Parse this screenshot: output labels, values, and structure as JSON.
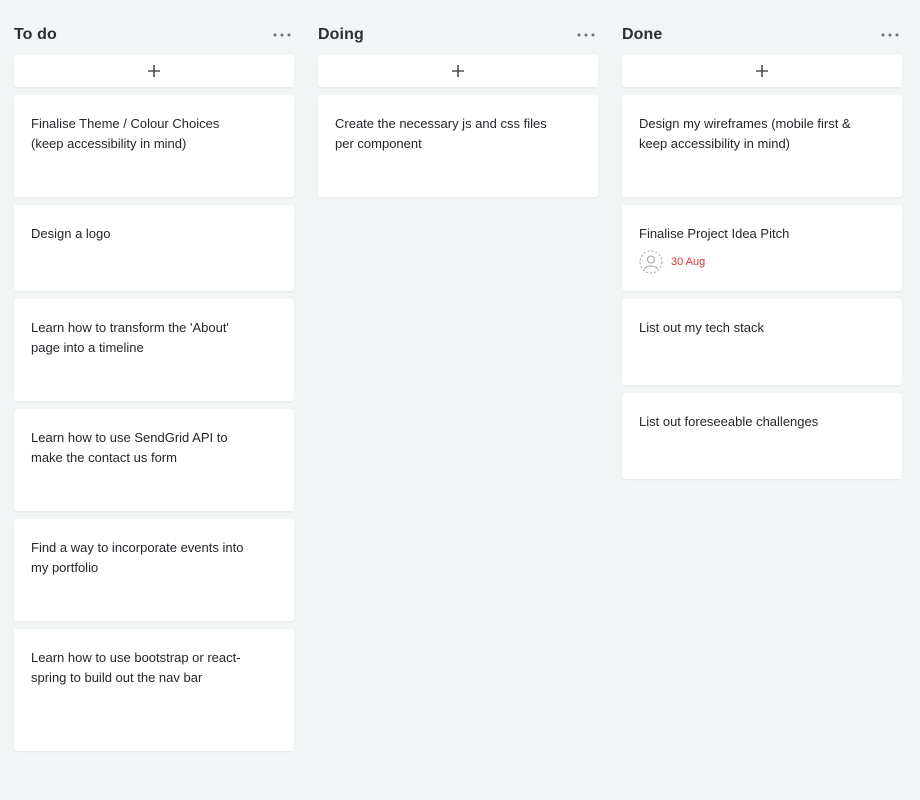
{
  "board": {
    "columns": [
      {
        "title": "To do",
        "cards": [
          {
            "text": "Finalise Theme / Colour Choices (keep accessibility in mind)"
          },
          {
            "text": "Design a logo"
          },
          {
            "text": "Learn how to transform the 'About' page into a timeline"
          },
          {
            "text": "Learn how to use SendGrid API to make the contact us form"
          },
          {
            "text": "Find a way to incorporate events into my portfolio"
          },
          {
            "text": "Learn how to use bootstrap or react-spring to build out the nav bar"
          }
        ]
      },
      {
        "title": "Doing",
        "cards": [
          {
            "text": "Create the necessary js and css files per component"
          }
        ]
      },
      {
        "title": "Done",
        "cards": [
          {
            "text": "Design my wireframes (mobile first & keep accessibility in mind)"
          },
          {
            "text": "Finalise Project Idea Pitch",
            "due_date": "30 Aug",
            "assignee_icon": "user-placeholder-icon"
          },
          {
            "text": "List out my tech stack"
          },
          {
            "text": "List out foreseeable challenges"
          }
        ]
      }
    ]
  },
  "icons": {
    "column_menu": "more-horizontal-icon",
    "add_card": "plus-icon"
  },
  "colors": {
    "background": "#f2f5f6",
    "card": "#ffffff",
    "due_date": "#e0313f",
    "title": "#2b2f33"
  }
}
